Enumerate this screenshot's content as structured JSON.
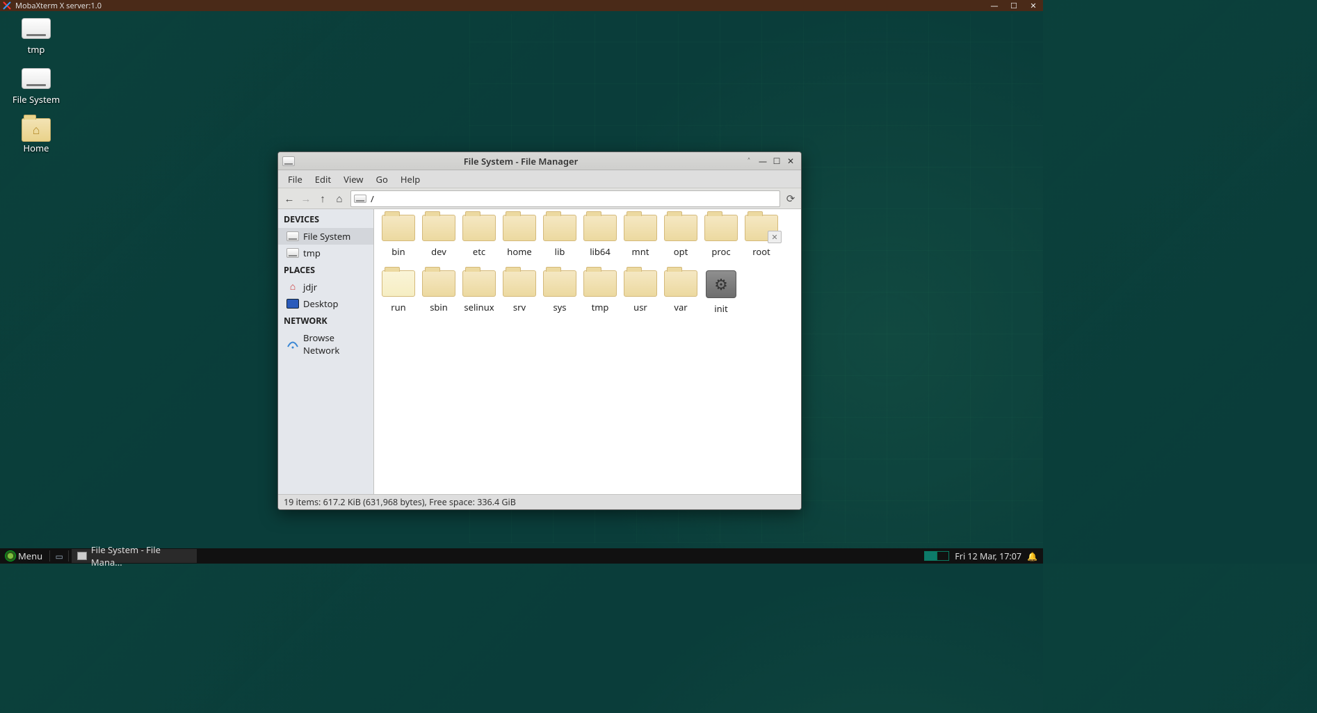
{
  "xbar": {
    "title": "MobaXterm X server:1.0"
  },
  "desktop": {
    "icons": [
      {
        "label": "tmp",
        "kind": "disk"
      },
      {
        "label": "File System",
        "kind": "disk"
      },
      {
        "label": "Home",
        "kind": "home"
      }
    ]
  },
  "fm": {
    "title": "File System - File Manager",
    "menubar": [
      "File",
      "Edit",
      "View",
      "Go",
      "Help"
    ],
    "path": "/",
    "sidebar": {
      "devices_header": "DEVICES",
      "devices": [
        {
          "label": "File System",
          "selected": true
        },
        {
          "label": "tmp",
          "selected": false
        }
      ],
      "places_header": "PLACES",
      "places": [
        {
          "label": "jdjr",
          "icon": "home"
        },
        {
          "label": "Desktop",
          "icon": "desk"
        }
      ],
      "network_header": "NETWORK",
      "network": [
        {
          "label": "Browse Network"
        }
      ]
    },
    "items": [
      {
        "name": "bin",
        "type": "folder"
      },
      {
        "name": "dev",
        "type": "folder"
      },
      {
        "name": "etc",
        "type": "folder"
      },
      {
        "name": "home",
        "type": "folder"
      },
      {
        "name": "lib",
        "type": "folder"
      },
      {
        "name": "lib64",
        "type": "folder"
      },
      {
        "name": "mnt",
        "type": "folder"
      },
      {
        "name": "opt",
        "type": "folder"
      },
      {
        "name": "proc",
        "type": "folder"
      },
      {
        "name": "root",
        "type": "folder-locked"
      },
      {
        "name": "run",
        "type": "folder-light"
      },
      {
        "name": "sbin",
        "type": "folder"
      },
      {
        "name": "selinux",
        "type": "folder"
      },
      {
        "name": "srv",
        "type": "folder"
      },
      {
        "name": "sys",
        "type": "folder"
      },
      {
        "name": "tmp",
        "type": "folder"
      },
      {
        "name": "usr",
        "type": "folder"
      },
      {
        "name": "var",
        "type": "folder"
      },
      {
        "name": "init",
        "type": "gear"
      }
    ],
    "status": "19 items: 617.2 KiB (631,968 bytes), Free space: 336.4 GiB"
  },
  "taskbar": {
    "menu_label": "Menu",
    "task_label": "File System - File Mana...",
    "clock": "Fri 12 Mar, 17:07"
  }
}
